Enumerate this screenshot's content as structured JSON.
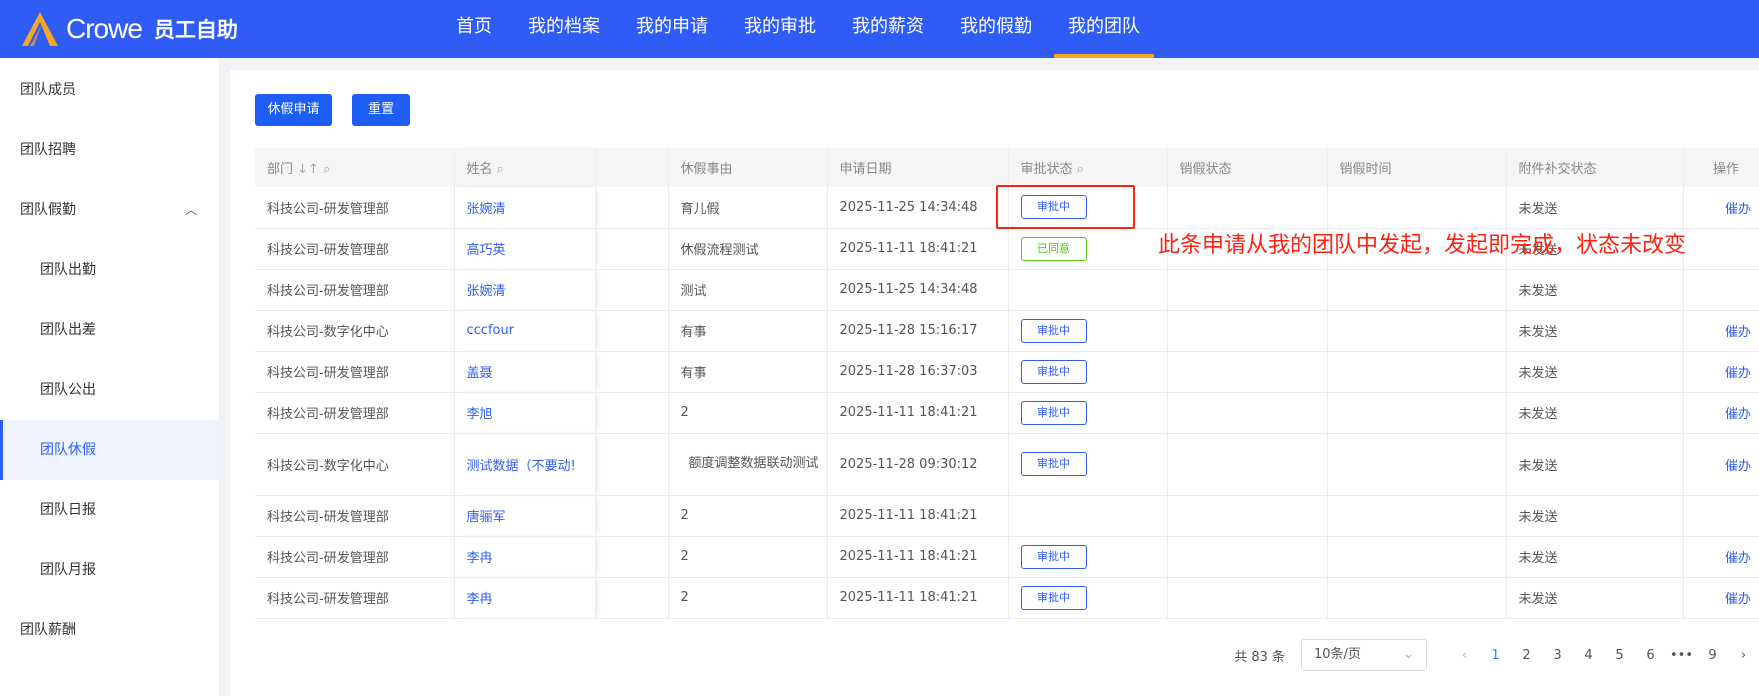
{
  "header": {
    "brand": "Crowe",
    "app_title": "员工自助",
    "nav": [
      "首页",
      "我的档案",
      "我的申请",
      "我的审批",
      "我的薪资",
      "我的假勤",
      "我的团队"
    ],
    "active_nav": 6
  },
  "sidebar": {
    "items": [
      "团队成员",
      "团队招聘",
      "团队假勤",
      "团队出勤",
      "团队出差",
      "团队公出",
      "团队休假",
      "团队日报",
      "团队月报",
      "团队薪酬"
    ],
    "active": 6
  },
  "toolbar": {
    "apply": "休假申请",
    "reset": "重置"
  },
  "table": {
    "headers": [
      "部门",
      "姓名",
      "",
      "休假事由",
      "申请日期",
      "审批状态",
      "销假状态",
      "销假时间",
      "附件补交状态",
      "操作"
    ],
    "rows": [
      [
        "科技公司-研发管理部",
        "张婉清",
        "育儿假",
        "2025-11-25 14:34:48",
        "审批中",
        "未发送",
        "催办"
      ],
      [
        "科技公司-研发管理部",
        "高巧英",
        "休假流程测试",
        "2025-11-11 18:41:21",
        "已同意",
        "未发送",
        ""
      ],
      [
        "科技公司-研发管理部",
        "张婉清",
        "测试",
        "2025-11-25 14:34:48",
        "",
        "未发送",
        ""
      ],
      [
        "科技公司-数字化中心",
        "cccfour",
        "有事",
        "2025-11-28 15:16:17",
        "审批中",
        "未发送",
        "催办"
      ],
      [
        "科技公司-研发管理部",
        "盖聂",
        "有事",
        "2025-11-28 16:37:03",
        "审批中",
        "未发送",
        "催办"
      ],
      [
        "科技公司-研发管理部",
        "李旭",
        "2",
        "2025-11-11 18:41:21",
        "审批中",
        "未发送",
        "催办"
      ],
      [
        "科技公司-数字化中心",
        "测试数据（不要动!",
        "额度调整数据联动测试",
        "2025-11-28 09:30:12",
        "审批中",
        "未发送",
        "催办"
      ],
      [
        "科技公司-研发管理部",
        "唐骊军",
        "2",
        "2025-11-11 18:41:21",
        "",
        "未发送",
        ""
      ],
      [
        "科技公司-研发管理部",
        "李冉",
        "2",
        "2025-11-11 18:41:21",
        "审批中",
        "未发送",
        "催办"
      ],
      [
        "科技公司-研发管理部",
        "李冉",
        "2",
        "2025-11-11 18:41:21",
        "审批中",
        "未发送",
        "催办"
      ]
    ]
  },
  "pagination": {
    "total": "共 83 条",
    "page_size": "10条/页",
    "pages": [
      "1",
      "2",
      "3",
      "4",
      "5",
      "6",
      "•••",
      "9"
    ],
    "current": "1"
  },
  "annotation": "此条申请从我的团队中发起，发起即完成，状态未改变",
  "colors": {
    "primary": "#2f5cf6",
    "annotation": "#ff2211",
    "approved": "#52c41a"
  }
}
